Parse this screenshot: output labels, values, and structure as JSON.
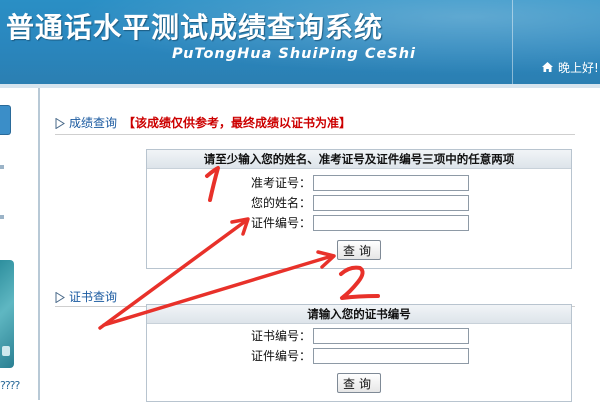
{
  "header": {
    "title": "普通话水平测试成绩查询系统",
    "subtitle": "PuTongHua ShuiPing CeShi",
    "greeting": "晚上好!",
    "home_icon": "home-icon"
  },
  "left_strip": {
    "glyphs": "????"
  },
  "score_query": {
    "title": "成绩查询",
    "notice": "【该成绩仅供参考，最终成绩以证书为准】",
    "instruction": "请至少输入您的姓名、准考证号及证件编号三项中的任意两项",
    "fields": [
      {
        "label": "准考证号：",
        "value": ""
      },
      {
        "label": "您的姓名：",
        "value": ""
      },
      {
        "label": "证件编号：",
        "value": ""
      }
    ],
    "button": "查询"
  },
  "certificate_query": {
    "title": "证书查询",
    "instruction": "请输入您的证书编号",
    "fields": [
      {
        "label": "证书编号：",
        "value": ""
      },
      {
        "label": "证件编号：",
        "value": ""
      }
    ],
    "button": "查询"
  },
  "annotation": {
    "mark1": "1",
    "mark2": "2",
    "color": "#e8312a"
  }
}
